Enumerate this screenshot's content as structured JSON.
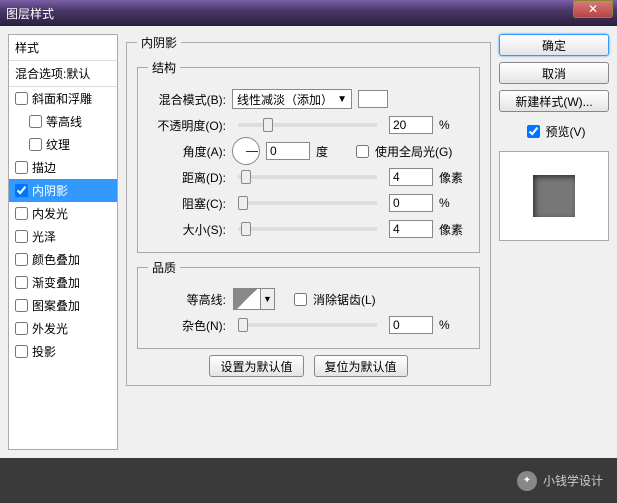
{
  "window": {
    "title": "图层样式"
  },
  "left": {
    "header": "样式",
    "blend_options": "混合选项:默认",
    "items": [
      {
        "label": "斜面和浮雕",
        "checked": false,
        "indent": false
      },
      {
        "label": "等高线",
        "checked": false,
        "indent": true
      },
      {
        "label": "纹理",
        "checked": false,
        "indent": true
      },
      {
        "label": "描边",
        "checked": false,
        "indent": false
      },
      {
        "label": "内阴影",
        "checked": true,
        "indent": false,
        "selected": true
      },
      {
        "label": "内发光",
        "checked": false,
        "indent": false
      },
      {
        "label": "光泽",
        "checked": false,
        "indent": false
      },
      {
        "label": "颜色叠加",
        "checked": false,
        "indent": false
      },
      {
        "label": "渐变叠加",
        "checked": false,
        "indent": false
      },
      {
        "label": "图案叠加",
        "checked": false,
        "indent": false
      },
      {
        "label": "外发光",
        "checked": false,
        "indent": false
      },
      {
        "label": "投影",
        "checked": false,
        "indent": false
      }
    ]
  },
  "main": {
    "section_title": "内阴影",
    "structure": {
      "legend": "结构",
      "blend_mode_label": "混合模式(B):",
      "blend_mode_value": "线性减淡（添加）",
      "opacity_label": "不透明度(O):",
      "opacity_value": "20",
      "opacity_unit": "%",
      "angle_label": "角度(A):",
      "angle_value": "0",
      "angle_unit": "度",
      "global_light_label": "使用全局光(G)",
      "global_light_checked": false,
      "distance_label": "距离(D):",
      "distance_value": "4",
      "distance_unit": "像素",
      "choke_label": "阻塞(C):",
      "choke_value": "0",
      "choke_unit": "%",
      "size_label": "大小(S):",
      "size_value": "4",
      "size_unit": "像素"
    },
    "quality": {
      "legend": "品质",
      "contour_label": "等高线:",
      "antialias_label": "消除锯齿(L)",
      "antialias_checked": false,
      "noise_label": "杂色(N):",
      "noise_value": "0",
      "noise_unit": "%"
    },
    "buttons": {
      "make_default": "设置为默认值",
      "reset_default": "复位为默认值"
    }
  },
  "right": {
    "ok": "确定",
    "cancel": "取消",
    "new_style": "新建样式(W)...",
    "preview_label": "预览(V)",
    "preview_checked": true
  },
  "footer": {
    "watermark": "小钱学设计"
  }
}
